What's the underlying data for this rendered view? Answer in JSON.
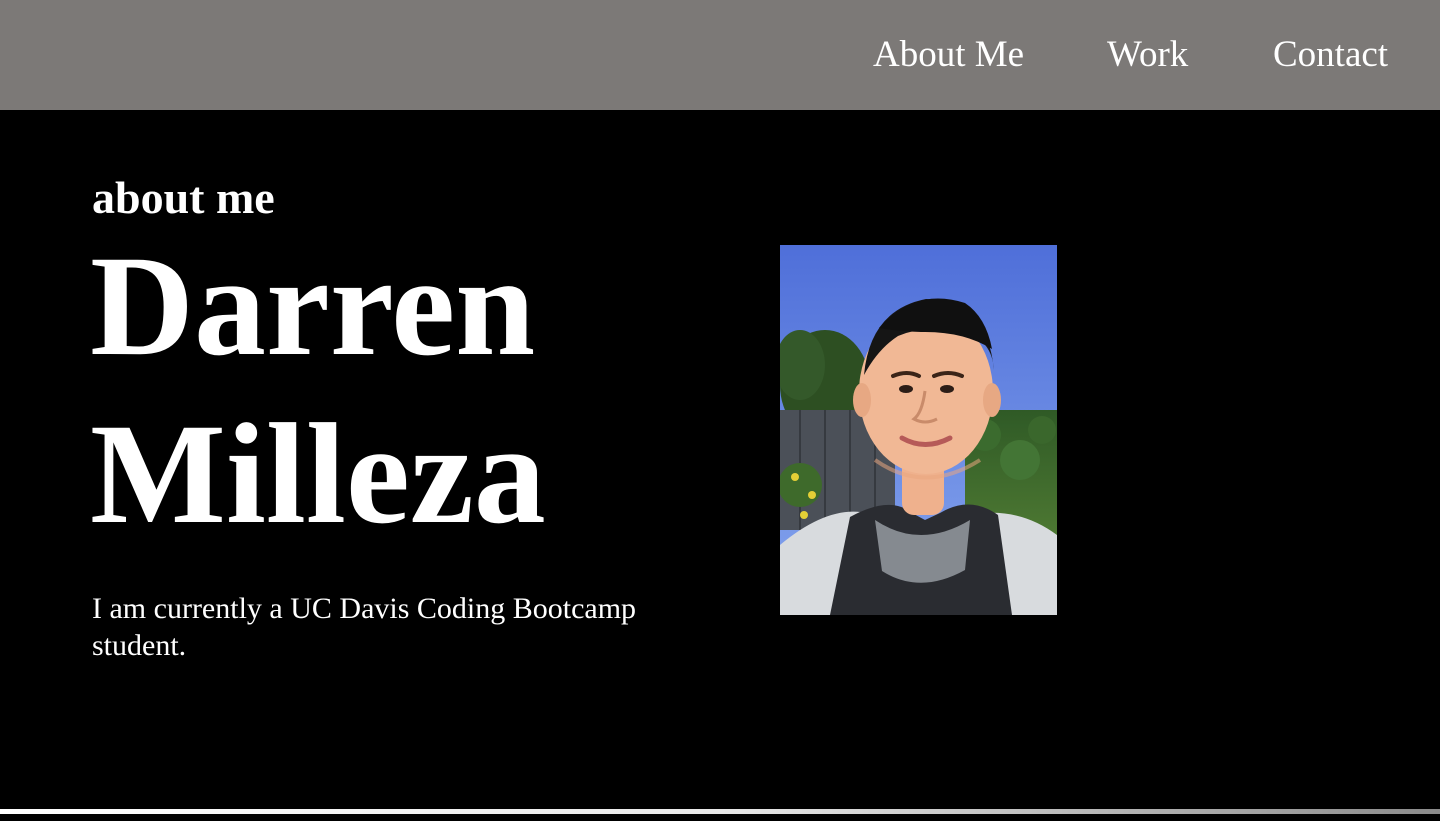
{
  "nav": {
    "items": [
      {
        "label": "About Me"
      },
      {
        "label": "Work"
      },
      {
        "label": "Contact"
      }
    ]
  },
  "about": {
    "section_label": "about me",
    "name_first": "Darren",
    "name_last": "Milleza",
    "bio": "I am currently a UC Davis Coding Bootcamp student."
  },
  "colors": {
    "page_background": "#000000",
    "navbar_background": "#7c7977",
    "text": "#ffffff"
  }
}
